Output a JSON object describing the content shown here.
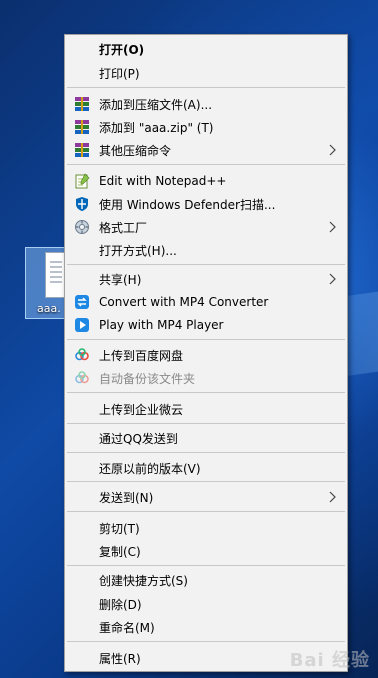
{
  "desktop": {
    "file_name": "aaa."
  },
  "menu": {
    "items": [
      {
        "label": "打开(O)",
        "icon": ""
      },
      {
        "label": "打印(P)",
        "icon": ""
      },
      {
        "label": "添加到压缩文件(A)...",
        "icon": "winrar-icon"
      },
      {
        "label": "添加到 \"aaa.zip\" (T)",
        "icon": "winrar-icon"
      },
      {
        "label": "其他压缩命令",
        "icon": "winrar-icon",
        "submenu": true
      },
      {
        "label": "Edit with Notepad++",
        "icon": "notepadpp-icon"
      },
      {
        "label": "使用 Windows Defender扫描...",
        "icon": "defender-shield-icon"
      },
      {
        "label": "格式工厂",
        "icon": "format-factory-icon",
        "submenu": true
      },
      {
        "label": "打开方式(H)...",
        "icon": ""
      },
      {
        "label": "共享(H)",
        "icon": "",
        "submenu": true
      },
      {
        "label": "Convert with MP4 Converter",
        "icon": "mp4-convert-icon"
      },
      {
        "label": "Play with MP4 Player",
        "icon": "mp4-play-icon"
      },
      {
        "label": "上传到百度网盘",
        "icon": "baidu-netdisk-icon"
      },
      {
        "label": "自动备份该文件夹",
        "icon": "baidu-netdisk-icon",
        "disabled": true
      },
      {
        "label": "上传到企业微云",
        "icon": ""
      },
      {
        "label": "通过QQ发送到",
        "icon": ""
      },
      {
        "label": "还原以前的版本(V)",
        "icon": ""
      },
      {
        "label": "发送到(N)",
        "icon": "",
        "submenu": true
      },
      {
        "label": "剪切(T)",
        "icon": ""
      },
      {
        "label": "复制(C)",
        "icon": ""
      },
      {
        "label": "创建快捷方式(S)",
        "icon": ""
      },
      {
        "label": "删除(D)",
        "icon": ""
      },
      {
        "label": "重命名(M)",
        "icon": ""
      },
      {
        "label": "属性(R)",
        "icon": ""
      }
    ]
  },
  "watermark": "Bai 经验",
  "colors": {
    "menu_bg": "#f2f2f2",
    "separator": "#c8c8c8",
    "disabled_text": "#8a8a8a",
    "mp4_blue": "#1e88e5",
    "defender_blue": "#0067b8"
  }
}
